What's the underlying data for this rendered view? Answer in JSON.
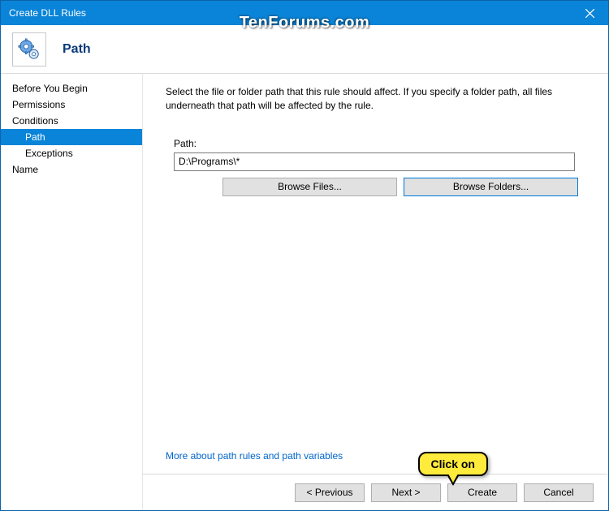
{
  "window": {
    "title": "Create DLL Rules"
  },
  "watermark": "TenForums.com",
  "header": {
    "page_title": "Path"
  },
  "sidebar": {
    "items": [
      {
        "label": "Before You Begin"
      },
      {
        "label": "Permissions"
      },
      {
        "label": "Conditions"
      },
      {
        "label": "Path"
      },
      {
        "label": "Exceptions"
      },
      {
        "label": "Name"
      }
    ]
  },
  "content": {
    "intro": "Select the file or folder path that this rule should affect. If you specify a folder path, all files underneath that path will be affected by the rule.",
    "path_label": "Path:",
    "path_value": "D:\\Programs\\*",
    "browse_files": "Browse Files...",
    "browse_folders": "Browse Folders...",
    "more_link": "More about path rules and path variables"
  },
  "footer": {
    "previous": "< Previous",
    "next": "Next >",
    "create": "Create",
    "cancel": "Cancel"
  },
  "callout": {
    "text": "Click on"
  }
}
